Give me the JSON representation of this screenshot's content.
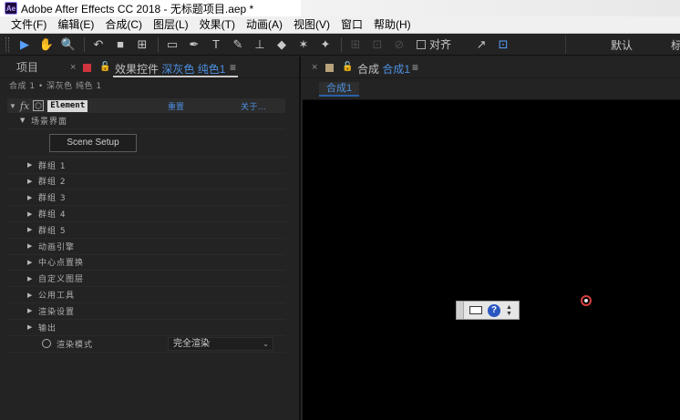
{
  "window": {
    "logo_text": "Ae",
    "title": "Adobe After Effects CC 2018 - 无标题项目.aep *"
  },
  "menu": [
    "文件(F)",
    "编辑(E)",
    "合成(C)",
    "图层(L)",
    "效果(T)",
    "动画(A)",
    "视图(V)",
    "窗口",
    "帮助(H)"
  ],
  "toolbar": {
    "tools": [
      {
        "name": "selection-tool",
        "glyph": "▶"
      },
      {
        "name": "hand-tool",
        "glyph": "✋"
      },
      {
        "name": "zoom-tool",
        "glyph": "🔍"
      },
      {
        "name": "rotate-tool",
        "glyph": "↶"
      },
      {
        "name": "camera-tool",
        "glyph": "■"
      },
      {
        "name": "pan-behind-tool",
        "glyph": "⊞"
      },
      {
        "name": "rectangle-tool",
        "glyph": "▭"
      },
      {
        "name": "pen-tool",
        "glyph": "✒"
      },
      {
        "name": "type-tool",
        "glyph": "T"
      },
      {
        "name": "brush-tool",
        "glyph": "✎"
      },
      {
        "name": "clone-stamp-tool",
        "glyph": "⊥"
      },
      {
        "name": "eraser-tool",
        "glyph": "◆"
      },
      {
        "name": "roto-brush-tool",
        "glyph": "✶"
      },
      {
        "name": "puppet-pin-tool",
        "glyph": "✦"
      }
    ],
    "align_label": "对齐",
    "workspace_label": "默认",
    "workspace_label_2": "标"
  },
  "left_panel": {
    "project_tab": "项目",
    "effects_tab_prefix": "效果控件",
    "effects_tab_target": "深灰色 纯色1",
    "breadcrumb": "合成 1 • 深灰色 纯色 1",
    "effect_name": "Element",
    "reset_label": "重置",
    "about_label": "关于...",
    "scene_group": "场景界面",
    "scene_button": "Scene Setup",
    "groups": [
      "群组 1",
      "群组 2",
      "群组 3",
      "群组 4",
      "群组 5",
      "动画引擎",
      "中心点置换",
      "自定义图层",
      "公用工具",
      "渲染设置",
      "输出"
    ],
    "render_mode_label": "渲染模式",
    "render_mode_value": "完全渲染"
  },
  "comp_panel": {
    "tab_prefix": "合成",
    "tab_name": "合成1",
    "chip": "合成1"
  },
  "colors": {
    "accent_blue": "#4d90e0",
    "label_red": "#d0343c",
    "label_tan": "#b8a27a",
    "panel_bg": "#232323",
    "viewer_bg": "#000000"
  }
}
